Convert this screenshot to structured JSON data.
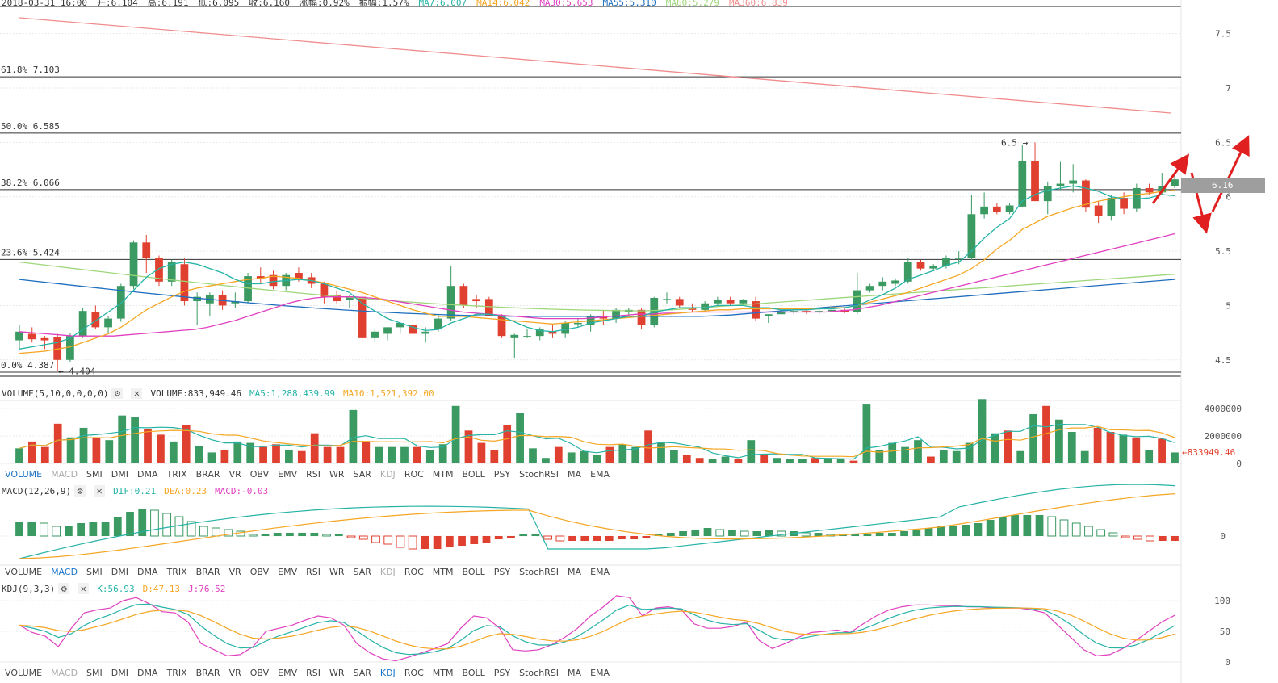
{
  "header": {
    "date_text": "2018-03-31 16:00",
    "items": [
      {
        "label": "开:",
        "value": "6.104",
        "color": "#333333"
      },
      {
        "label": "高:",
        "value": "6.191",
        "color": "#333333"
      },
      {
        "label": "低:",
        "value": "6.095",
        "color": "#333333"
      },
      {
        "label": "收:",
        "value": "6.160",
        "color": "#333333"
      },
      {
        "label": "涨幅:",
        "value": "0.92%",
        "color": "#333333"
      },
      {
        "label": "振幅:",
        "value": "1.57%",
        "color": "#333333"
      },
      {
        "label": "MA7:",
        "value": "6.007",
        "color": "#26b3a6"
      },
      {
        "label": "MA14:",
        "value": "6.042",
        "color": "#f5a623"
      },
      {
        "label": "MA30:",
        "value": "5.653",
        "color": "#e040c0"
      },
      {
        "label": "MA55:",
        "value": "5.310",
        "color": "#1f6fbf"
      },
      {
        "label": "MA60:",
        "value": "5.279",
        "color": "#9ed67a"
      },
      {
        "label": "MA360:",
        "value": "6.839",
        "color": "#f08c8c"
      }
    ]
  },
  "price_axis_ticks": [
    "7.5",
    "7",
    "6.5",
    "6",
    "5.5",
    "5",
    "4.5"
  ],
  "price_tag": "6.16",
  "fib_levels": [
    {
      "label": "61.8%",
      "value": "7.103",
      "price": 7.103
    },
    {
      "label": "50.0%",
      "value": "6.585",
      "price": 6.585
    },
    {
      "label": "38.2%",
      "value": "6.066",
      "price": 6.066
    },
    {
      "label": "23.6%",
      "value": "5.424",
      "price": 5.424
    },
    {
      "label": "0.0%",
      "value": "4.387",
      "price": 4.387
    }
  ],
  "annotations": {
    "high_label": "6.5 →",
    "low_label": "← 4.404"
  },
  "volume": {
    "title": "VOLUME(5,10,0,0,0,0)",
    "value_label": "VOLUME:833,949.46",
    "ma5_label": "MA5:1,288,439.99",
    "ma10_label": "MA10:1,521,392.00",
    "axis_ticks": [
      "4000000",
      "2000000",
      "0"
    ],
    "current_tag": "←833949.46"
  },
  "macd": {
    "title": "MACD(12,26,9)",
    "dif_label": "DIF:0.21",
    "dea_label": "DEA:0.23",
    "macd_label": "MACD:-0.03",
    "axis_tick": "0"
  },
  "kdj": {
    "title": "KDJ(9,3,3)",
    "k_label": "K:56.93",
    "d_label": "D:47.13",
    "j_label": "J:76.52",
    "axis_ticks": [
      "100",
      "50",
      "0"
    ]
  },
  "tabs": [
    "VOLUME",
    "MACD",
    "SMI",
    "DMI",
    "DMA",
    "TRIX",
    "BRAR",
    "VR",
    "OBV",
    "EMV",
    "RSI",
    "WR",
    "SAR",
    "KDJ",
    "ROC",
    "MTM",
    "BOLL",
    "PSY",
    "StochRSI",
    "MA",
    "EMA"
  ],
  "tab_rows": [
    {
      "active": "VOLUME"
    },
    {
      "active": "MACD"
    },
    {
      "active": "KDJ"
    }
  ],
  "colors": {
    "up": "#3a9a62",
    "down": "#e0402f",
    "ma7": "#26b3a6",
    "ma14": "#f5a623",
    "ma30": "#e040c0",
    "ma55": "#1f6fbf",
    "ma60": "#9ed67a",
    "ma360": "#f08c8c",
    "arrow": "#e02020"
  },
  "chart_data": {
    "type": "candlestick",
    "ylim": [
      4.35,
      7.75
    ],
    "candles": [
      {
        "o": 4.68,
        "h": 4.82,
        "l": 4.6,
        "c": 4.76
      },
      {
        "o": 4.74,
        "h": 4.8,
        "l": 4.66,
        "c": 4.69
      },
      {
        "o": 4.7,
        "h": 4.72,
        "l": 4.6,
        "c": 4.68
      },
      {
        "o": 4.71,
        "h": 4.74,
        "l": 4.4,
        "c": 4.5
      },
      {
        "o": 4.5,
        "h": 4.75,
        "l": 4.48,
        "c": 4.72
      },
      {
        "o": 4.72,
        "h": 4.98,
        "l": 4.7,
        "c": 4.95
      },
      {
        "o": 4.94,
        "h": 5.0,
        "l": 4.78,
        "c": 4.8
      },
      {
        "o": 4.8,
        "h": 4.9,
        "l": 4.75,
        "c": 4.88
      },
      {
        "o": 4.88,
        "h": 5.2,
        "l": 4.85,
        "c": 5.18
      },
      {
        "o": 5.18,
        "h": 5.6,
        "l": 5.15,
        "c": 5.58
      },
      {
        "o": 5.58,
        "h": 5.65,
        "l": 5.3,
        "c": 5.44
      },
      {
        "o": 5.44,
        "h": 5.46,
        "l": 5.18,
        "c": 5.22
      },
      {
        "o": 5.22,
        "h": 5.42,
        "l": 5.18,
        "c": 5.4
      },
      {
        "o": 5.38,
        "h": 5.44,
        "l": 5.0,
        "c": 5.04
      },
      {
        "o": 5.04,
        "h": 5.12,
        "l": 4.82,
        "c": 5.08
      },
      {
        "o": 5.02,
        "h": 5.12,
        "l": 4.9,
        "c": 5.1
      },
      {
        "o": 5.1,
        "h": 5.14,
        "l": 4.96,
        "c": 5.0
      },
      {
        "o": 5.02,
        "h": 5.12,
        "l": 4.98,
        "c": 5.04
      },
      {
        "o": 5.04,
        "h": 5.3,
        "l": 5.02,
        "c": 5.27
      },
      {
        "o": 5.27,
        "h": 5.35,
        "l": 5.2,
        "c": 5.25
      },
      {
        "o": 5.28,
        "h": 5.32,
        "l": 5.15,
        "c": 5.18
      },
      {
        "o": 5.18,
        "h": 5.3,
        "l": 5.14,
        "c": 5.28
      },
      {
        "o": 5.3,
        "h": 5.35,
        "l": 5.22,
        "c": 5.24
      },
      {
        "o": 5.26,
        "h": 5.3,
        "l": 5.16,
        "c": 5.2
      },
      {
        "o": 5.2,
        "h": 5.22,
        "l": 5.02,
        "c": 5.08
      },
      {
        "o": 5.1,
        "h": 5.14,
        "l": 5.02,
        "c": 5.04
      },
      {
        "o": 5.05,
        "h": 5.1,
        "l": 4.98,
        "c": 5.08
      },
      {
        "o": 5.08,
        "h": 5.12,
        "l": 4.66,
        "c": 4.7
      },
      {
        "o": 4.7,
        "h": 4.78,
        "l": 4.66,
        "c": 4.76
      },
      {
        "o": 4.74,
        "h": 4.8,
        "l": 4.68,
        "c": 4.8
      },
      {
        "o": 4.8,
        "h": 4.84,
        "l": 4.74,
        "c": 4.84
      },
      {
        "o": 4.82,
        "h": 4.86,
        "l": 4.7,
        "c": 4.74
      },
      {
        "o": 4.74,
        "h": 4.8,
        "l": 4.66,
        "c": 4.76
      },
      {
        "o": 4.78,
        "h": 4.92,
        "l": 4.76,
        "c": 4.88
      },
      {
        "o": 4.88,
        "h": 5.36,
        "l": 4.86,
        "c": 5.18
      },
      {
        "o": 5.18,
        "h": 5.2,
        "l": 4.98,
        "c": 5.0
      },
      {
        "o": 5.06,
        "h": 5.1,
        "l": 4.98,
        "c": 5.04
      },
      {
        "o": 5.06,
        "h": 5.08,
        "l": 4.9,
        "c": 4.9
      },
      {
        "o": 4.9,
        "h": 4.92,
        "l": 4.7,
        "c": 4.72
      },
      {
        "o": 4.7,
        "h": 4.74,
        "l": 4.52,
        "c": 4.73
      },
      {
        "o": 4.72,
        "h": 4.78,
        "l": 4.7,
        "c": 4.72
      },
      {
        "o": 4.72,
        "h": 4.8,
        "l": 4.68,
        "c": 4.78
      },
      {
        "o": 4.76,
        "h": 4.82,
        "l": 4.7,
        "c": 4.74
      },
      {
        "o": 4.74,
        "h": 4.86,
        "l": 4.7,
        "c": 4.84
      },
      {
        "o": 4.84,
        "h": 4.88,
        "l": 4.8,
        "c": 4.84
      },
      {
        "o": 4.82,
        "h": 4.92,
        "l": 4.76,
        "c": 4.9
      },
      {
        "o": 4.9,
        "h": 4.96,
        "l": 4.82,
        "c": 4.88
      },
      {
        "o": 4.88,
        "h": 4.98,
        "l": 4.84,
        "c": 4.96
      },
      {
        "o": 4.94,
        "h": 4.98,
        "l": 4.9,
        "c": 4.96
      },
      {
        "o": 4.96,
        "h": 4.98,
        "l": 4.78,
        "c": 4.82
      },
      {
        "o": 4.82,
        "h": 5.08,
        "l": 4.8,
        "c": 5.07
      },
      {
        "o": 5.06,
        "h": 5.12,
        "l": 5.02,
        "c": 5.06
      },
      {
        "o": 5.06,
        "h": 5.08,
        "l": 4.98,
        "c": 5.0
      },
      {
        "o": 4.98,
        "h": 5.02,
        "l": 4.94,
        "c": 4.96
      },
      {
        "o": 4.96,
        "h": 5.04,
        "l": 4.94,
        "c": 5.02
      },
      {
        "o": 5.02,
        "h": 5.08,
        "l": 5.0,
        "c": 5.05
      },
      {
        "o": 5.05,
        "h": 5.08,
        "l": 5.0,
        "c": 5.02
      },
      {
        "o": 5.02,
        "h": 5.06,
        "l": 5.0,
        "c": 5.05
      },
      {
        "o": 5.04,
        "h": 5.08,
        "l": 4.86,
        "c": 4.88
      },
      {
        "o": 4.9,
        "h": 4.92,
        "l": 4.84,
        "c": 4.92
      },
      {
        "o": 4.92,
        "h": 4.96,
        "l": 4.9,
        "c": 4.94
      },
      {
        "o": 4.94,
        "h": 4.98,
        "l": 4.92,
        "c": 4.95
      },
      {
        "o": 4.95,
        "h": 4.98,
        "l": 4.92,
        "c": 4.94
      },
      {
        "o": 4.94,
        "h": 4.98,
        "l": 4.92,
        "c": 4.95
      },
      {
        "o": 4.95,
        "h": 4.98,
        "l": 4.94,
        "c": 4.96
      },
      {
        "o": 4.96,
        "h": 4.98,
        "l": 4.93,
        "c": 4.94
      },
      {
        "o": 4.94,
        "h": 5.3,
        "l": 4.92,
        "c": 5.14
      },
      {
        "o": 5.14,
        "h": 5.2,
        "l": 5.12,
        "c": 5.18
      },
      {
        "o": 5.18,
        "h": 5.26,
        "l": 5.14,
        "c": 5.22
      },
      {
        "o": 5.2,
        "h": 5.25,
        "l": 5.18,
        "c": 5.23
      },
      {
        "o": 5.22,
        "h": 5.44,
        "l": 5.2,
        "c": 5.4
      },
      {
        "o": 5.4,
        "h": 5.42,
        "l": 5.32,
        "c": 5.34
      },
      {
        "o": 5.34,
        "h": 5.38,
        "l": 5.32,
        "c": 5.36
      },
      {
        "o": 5.36,
        "h": 5.46,
        "l": 5.34,
        "c": 5.44
      },
      {
        "o": 5.44,
        "h": 5.5,
        "l": 5.38,
        "c": 5.44
      },
      {
        "o": 5.44,
        "h": 6.02,
        "l": 5.42,
        "c": 5.84
      },
      {
        "o": 5.84,
        "h": 6.04,
        "l": 5.8,
        "c": 5.91
      },
      {
        "o": 5.91,
        "h": 5.94,
        "l": 5.84,
        "c": 5.86
      },
      {
        "o": 5.86,
        "h": 5.94,
        "l": 5.84,
        "c": 5.92
      },
      {
        "o": 5.91,
        "h": 6.48,
        "l": 5.9,
        "c": 6.33
      },
      {
        "o": 6.33,
        "h": 6.5,
        "l": 5.96,
        "c": 5.96
      },
      {
        "o": 5.96,
        "h": 6.14,
        "l": 5.84,
        "c": 6.1
      },
      {
        "o": 6.1,
        "h": 6.32,
        "l": 6.06,
        "c": 6.12
      },
      {
        "o": 6.12,
        "h": 6.3,
        "l": 6.04,
        "c": 6.15
      },
      {
        "o": 6.15,
        "h": 6.16,
        "l": 5.86,
        "c": 5.9
      },
      {
        "o": 5.92,
        "h": 5.96,
        "l": 5.76,
        "c": 5.82
      },
      {
        "o": 5.82,
        "h": 6.02,
        "l": 5.78,
        "c": 5.99
      },
      {
        "o": 5.99,
        "h": 6.04,
        "l": 5.84,
        "c": 5.89
      },
      {
        "o": 5.89,
        "h": 6.12,
        "l": 5.86,
        "c": 6.08
      },
      {
        "o": 6.08,
        "h": 6.12,
        "l": 6.02,
        "c": 6.04
      },
      {
        "o": 6.04,
        "h": 6.22,
        "l": 6.02,
        "c": 6.1
      },
      {
        "o": 6.1,
        "h": 6.2,
        "l": 6.08,
        "c": 6.16
      }
    ],
    "ma7": [
      4.6,
      4.62,
      4.64,
      4.66,
      4.7,
      4.78,
      4.86,
      4.94,
      5.02,
      5.14,
      5.26,
      5.34,
      5.38,
      5.4,
      5.38,
      5.34,
      5.3,
      5.24,
      5.2,
      5.2,
      5.22,
      5.23,
      5.24,
      5.23,
      5.2,
      5.16,
      5.12,
      5.02,
      4.95,
      4.88,
      4.84,
      4.8,
      4.77,
      4.78,
      4.84,
      4.88,
      4.92,
      4.92,
      4.9,
      4.85,
      4.8,
      4.77,
      4.76,
      4.78,
      4.8,
      4.84,
      4.86,
      4.88,
      4.9,
      4.9,
      4.94,
      4.96,
      4.98,
      4.98,
      4.98,
      5.0,
      5.0,
      5.0,
      4.98,
      4.98,
      4.96,
      4.96,
      4.96,
      4.97,
      4.97,
      4.98,
      5.0,
      5.05,
      5.1,
      5.16,
      5.24,
      5.28,
      5.32,
      5.37,
      5.4,
      5.5,
      5.62,
      5.72,
      5.8,
      5.96,
      6.02,
      6.06,
      6.08,
      6.1,
      6.08,
      6.05,
      6.0,
      5.98,
      5.98,
      5.99,
      6.02,
      6.01
    ],
    "ma14": [
      4.56,
      4.57,
      4.58,
      4.6,
      4.62,
      4.66,
      4.7,
      4.74,
      4.8,
      4.88,
      4.96,
      5.02,
      5.08,
      5.13,
      5.16,
      5.18,
      5.2,
      5.22,
      5.24,
      5.25,
      5.27,
      5.26,
      5.25,
      5.23,
      5.21,
      5.18,
      5.15,
      5.12,
      5.08,
      5.04,
      5.0,
      4.96,
      4.93,
      4.9,
      4.9,
      4.9,
      4.89,
      4.88,
      4.87,
      4.86,
      4.85,
      4.84,
      4.83,
      4.84,
      4.85,
      4.86,
      4.87,
      4.88,
      4.89,
      4.9,
      4.91,
      4.92,
      4.93,
      4.94,
      4.95,
      4.96,
      4.96,
      4.97,
      4.97,
      4.97,
      4.97,
      4.97,
      4.97,
      4.97,
      4.98,
      4.98,
      5.0,
      5.03,
      5.06,
      5.09,
      5.12,
      5.16,
      5.2,
      5.24,
      5.28,
      5.34,
      5.42,
      5.52,
      5.6,
      5.7,
      5.76,
      5.82,
      5.86,
      5.9,
      5.93,
      5.96,
      5.98,
      6.0,
      6.02,
      6.03,
      6.05,
      6.06
    ],
    "ma30": [
      4.76,
      4.75,
      4.74,
      4.73,
      4.72,
      4.72,
      4.72,
      4.72,
      4.73,
      4.74,
      4.75,
      4.76,
      4.77,
      4.78,
      4.8,
      4.83,
      4.86,
      4.9,
      4.94,
      4.98,
      5.02,
      5.05,
      5.07,
      5.08,
      5.08,
      5.08,
      5.07,
      5.06,
      5.04,
      5.02,
      5.0,
      4.98,
      4.96,
      4.94,
      4.93,
      4.92,
      4.91,
      4.9,
      4.89,
      4.88,
      4.88,
      4.88,
      4.88,
      4.89,
      4.9,
      4.91,
      4.92,
      4.92,
      4.93,
      4.93,
      4.94,
      4.94,
      4.94,
      4.94,
      4.94,
      4.94,
      4.94,
      4.94,
      4.94,
      4.94,
      4.94,
      4.95,
      4.96,
      4.98,
      5.0,
      5.03,
      5.06,
      5.09,
      5.12,
      5.15,
      5.18,
      5.21,
      5.24,
      5.27,
      5.3,
      5.33,
      5.36,
      5.39,
      5.42,
      5.45,
      5.48,
      5.51,
      5.54,
      5.57,
      5.6,
      5.63,
      5.66
    ]
  }
}
